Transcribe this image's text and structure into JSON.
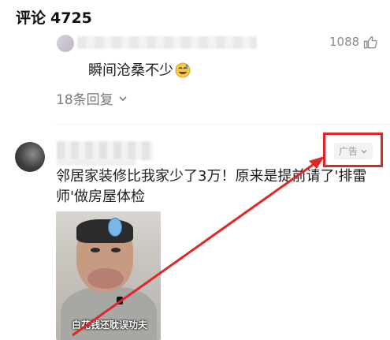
{
  "header": {
    "label": "评论",
    "count": "4725"
  },
  "reply": {
    "likes": "1088",
    "text": "瞬间沧桑不少",
    "more_replies": "18条回复"
  },
  "ad_comment": {
    "badge": "广告",
    "text": "邻居家装修比我家少了3万！原来是提前请了'排雷师'做房屋体检",
    "image_caption": "白花钱还耽误功夫"
  },
  "colors": {
    "highlight": "#e02626",
    "muted_text": "#8a8a8a"
  },
  "icons": {
    "like": "thumbs-up-icon",
    "emoji": "sweat-smile-emoji-icon",
    "chevron": "chevron-down-icon"
  }
}
